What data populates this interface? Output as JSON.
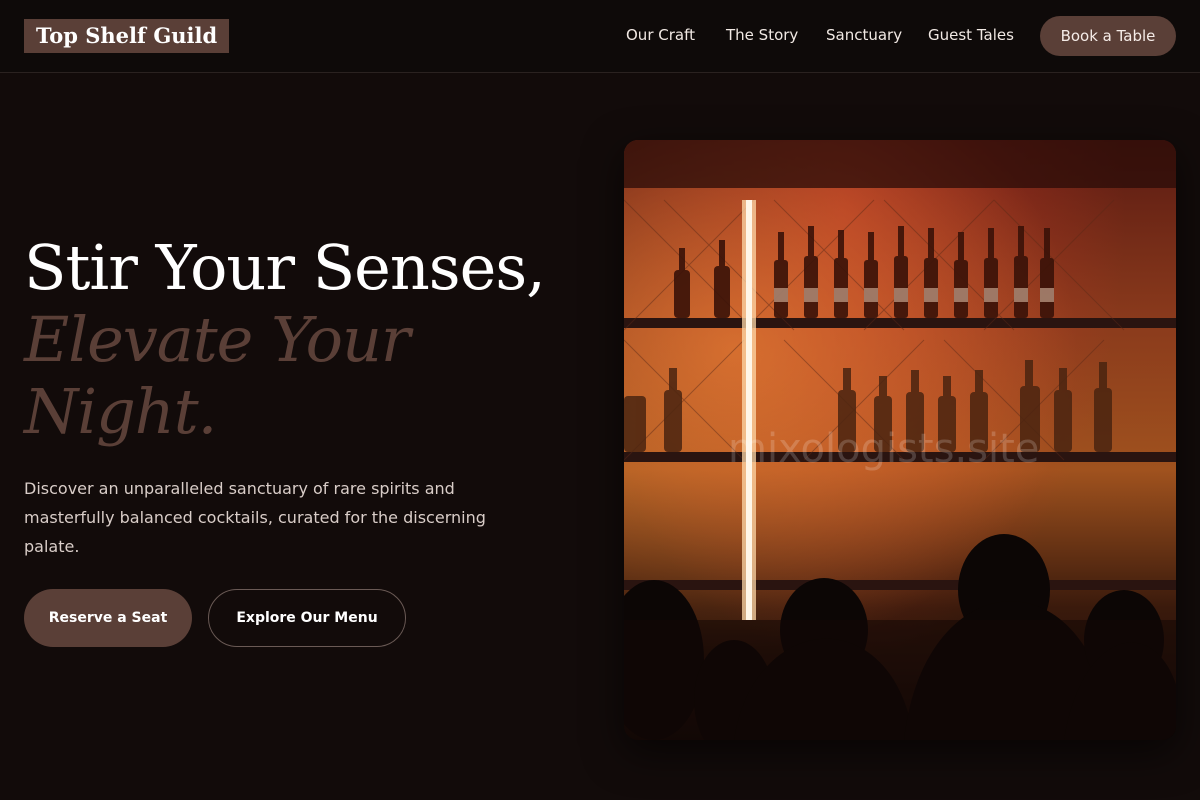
{
  "header": {
    "logo": "Top Shelf Guild",
    "nav": [
      {
        "label": "Our Craft"
      },
      {
        "label": "The Story"
      },
      {
        "label": "Sanctuary"
      },
      {
        "label": "Guest Tales"
      }
    ],
    "cta": "Book a Table"
  },
  "hero": {
    "title_line1": "Stir Your Senses,",
    "title_line2": "Elevate Your Night.",
    "description": "Discover an unparalleled sanctuary of rare spirits and masterfully balanced cocktails, curated for the discerning palate.",
    "primary_button": "Reserve a Seat",
    "secondary_button": "Explore Our Menu",
    "image_watermark": "mixologists.site"
  },
  "colors": {
    "background": "#120b0a",
    "header_bg": "#0e0a09",
    "accent": "#5a3f37",
    "text": "#f1e9e4"
  }
}
